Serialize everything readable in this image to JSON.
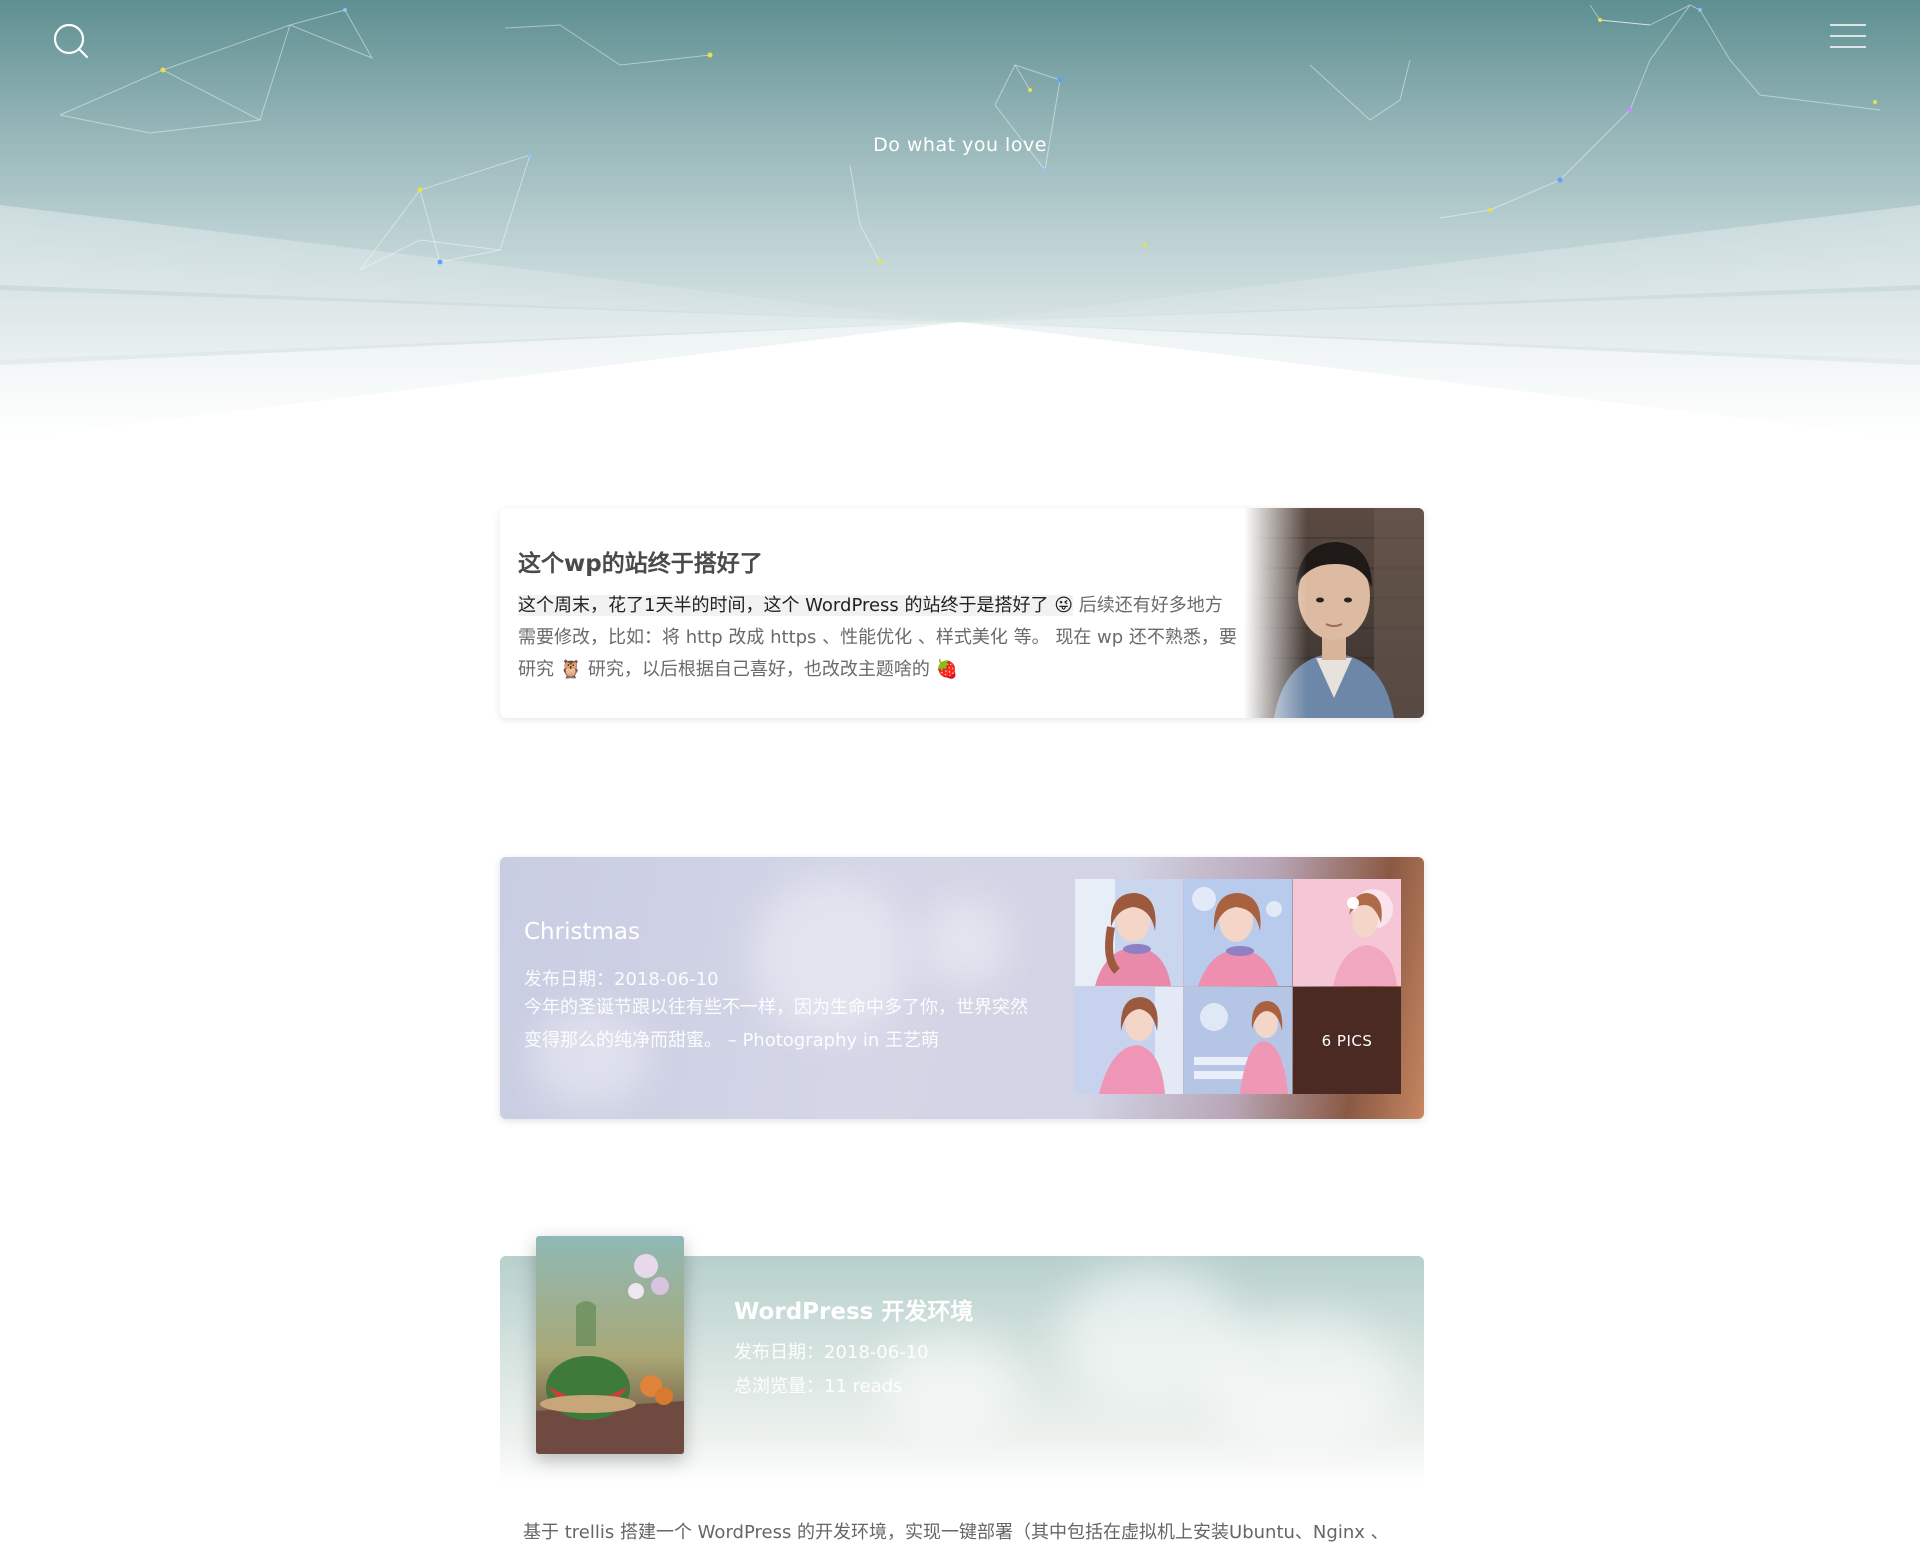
{
  "header": {
    "tagline": "Do what you love",
    "search_icon": "search-icon",
    "menu_icon": "hamburger-menu-icon"
  },
  "posts": [
    {
      "title": "这个wp的站终于搭好了",
      "excerpt_highlight": "这个周末，花了1天半的时间，这个 WordPress 的站终于是搭好了 😜",
      "excerpt_rest": " 后续还有好多地方需要修改，比如：将 http 改成 https 、性能优化 、样式美化 等。 现在 wp 还不熟悉，要研究 🦉 研究，以后根据自己喜好，也改改主题啥的 🍓"
    },
    {
      "title": "Christmas",
      "date_label": "发布日期：",
      "date": "2018-06-10",
      "excerpt": "今年的圣诞节跟以往有些不一样，因为生命中多了你，世界突然变得那么的纯净而甜蜜。 – Photography in 王艺萌",
      "pics_label": "6 PICS"
    },
    {
      "title": "WordPress 开发环境",
      "date_label": "发布日期：",
      "date": "2018-06-10",
      "views_label": "总浏览量：",
      "views": "11 reads",
      "excerpt": "基于 trellis 搭建一个 WordPress 的开发环境，实现一键部署（其中包括在虚拟机上安装Ubuntu、Nginx 、"
    }
  ],
  "colors": {
    "hero_top": "#5e8f91",
    "card_text": "#555555",
    "pics_overlay": "#4a2a22"
  }
}
